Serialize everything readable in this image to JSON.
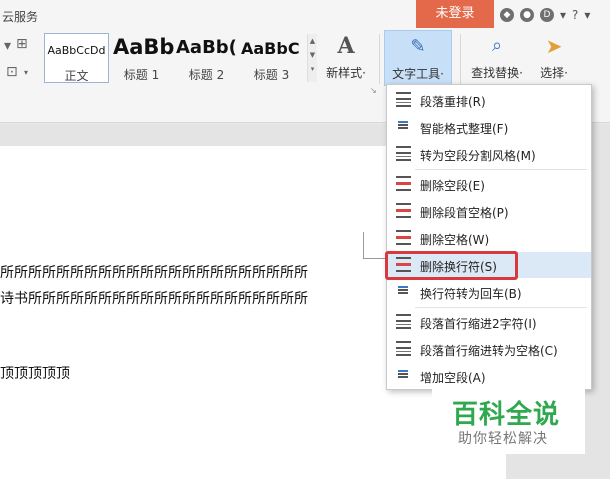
{
  "titlebar": {
    "cloud_label": "云服务",
    "login_label": "未登录",
    "icons": [
      "shirt-icon",
      "bulb-icon",
      "cloud-drive-icon",
      "help-icon"
    ],
    "help_text": "?",
    "drop_arrow": "▾"
  },
  "ribbon": {
    "styles": [
      {
        "sample": "AaBbCcDd",
        "label": "正文"
      },
      {
        "sample": "AaBb",
        "label": "标题 1"
      },
      {
        "sample": "AaBb(",
        "label": "标题 2"
      },
      {
        "sample": "AaBbC",
        "label": "标题 3"
      }
    ],
    "new_style_label": "新样式·",
    "text_tool_label": "文字工具·",
    "find_replace_label": "查找替换·",
    "select_label": "选择·"
  },
  "document": {
    "line1": "所所所所所所所所所所所所所所所所所所所所所所",
    "line2": "诗书所所所所所所所所所所所所所所所所所所所所",
    "line3": "顶顶顶顶顶"
  },
  "menu": {
    "items": [
      {
        "label": "段落重排(R)",
        "icon": "paragraph-rearrange-icon"
      },
      {
        "label": "智能格式整理(F)",
        "icon": "smart-format-icon"
      },
      {
        "label": "转为空段分割风格(M)",
        "icon": "split-style-icon"
      },
      {
        "label": "删除空段(E)",
        "icon": "delete-empty-paragraph-icon"
      },
      {
        "label": "删除段首空格(P)",
        "icon": "delete-leading-space-icon"
      },
      {
        "label": "删除空格(W)",
        "icon": "delete-space-icon"
      },
      {
        "label": "删除换行符(S)",
        "icon": "delete-linebreak-icon"
      },
      {
        "label": "换行符转为回车(B)",
        "icon": "linebreak-to-enter-icon"
      },
      {
        "label": "段落首行缩进2字符(I)",
        "icon": "indent-icon"
      },
      {
        "label": "段落首行缩进转为空格(C)",
        "icon": "indent-to-space-icon"
      },
      {
        "label": "增加空段(A)",
        "icon": "add-empty-paragraph-icon"
      }
    ],
    "highlighted_index": 6
  },
  "watermark": {
    "title": "百科全说",
    "subtitle": "助你轻松解决"
  },
  "colors": {
    "login": "#e3694a",
    "highlight_border": "#d9383d",
    "watermark_green": "#2fa84e"
  }
}
